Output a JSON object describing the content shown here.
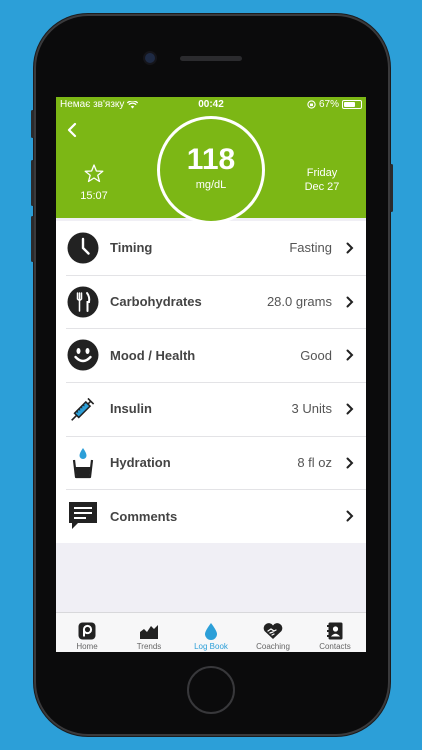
{
  "status_bar": {
    "carrier": "Немає зв'язку",
    "time": "00:42",
    "battery": "67%",
    "battery_level": 0.67
  },
  "header": {
    "reading_value": "118",
    "reading_unit": "mg/dL",
    "time": "15:07",
    "day": "Friday",
    "date": "Dec 27",
    "accent_color": "#7cb715"
  },
  "entries": [
    {
      "icon": "clock-icon",
      "label": "Timing",
      "value": "Fasting"
    },
    {
      "icon": "fork-knife-icon",
      "label": "Carbohydrates",
      "value": "28.0 grams"
    },
    {
      "icon": "smiley-icon",
      "label": "Mood / Health",
      "value": "Good"
    },
    {
      "icon": "syringe-icon",
      "label": "Insulin",
      "value": "3 Units"
    },
    {
      "icon": "water-glass-icon",
      "label": "Hydration",
      "value": "8 fl oz"
    },
    {
      "icon": "comment-icon",
      "label": "Comments",
      "value": ""
    }
  ],
  "tabs": [
    {
      "icon": "home-icon",
      "label": "Home"
    },
    {
      "icon": "trends-icon",
      "label": "Trends"
    },
    {
      "icon": "water-drop-icon",
      "label": "Log Book",
      "active": true
    },
    {
      "icon": "handshake-icon",
      "label": "Coaching"
    },
    {
      "icon": "contacts-icon",
      "label": "Contacts"
    }
  ]
}
